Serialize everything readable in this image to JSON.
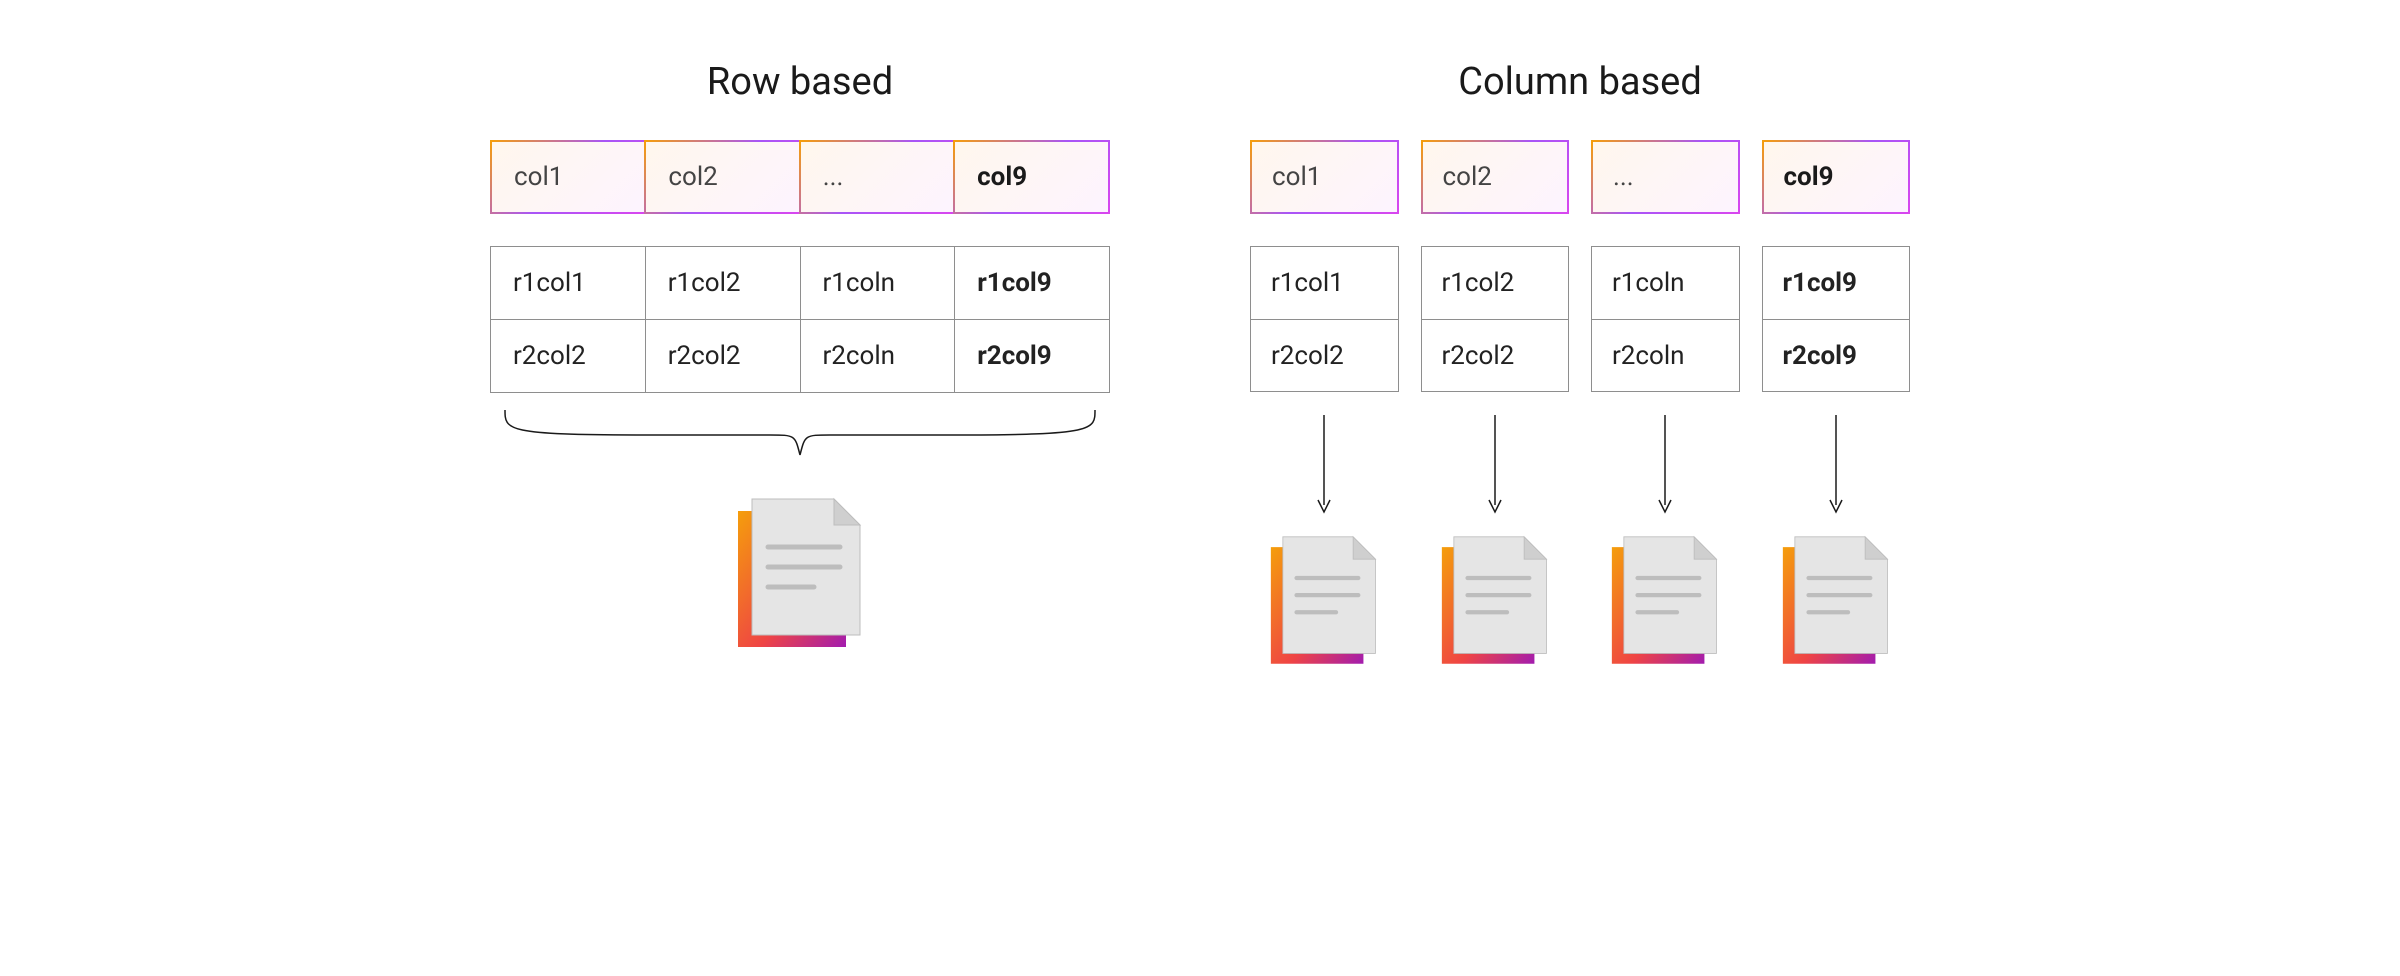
{
  "row_section": {
    "title": "Row based",
    "headers": [
      "col1",
      "col2",
      "...",
      "col9"
    ],
    "header_bold_index": 3,
    "rows": [
      [
        "r1col1",
        "r1col2",
        "r1coln",
        "r1col9"
      ],
      [
        "r2col2",
        "r2col2",
        "r2coln",
        "r2col9"
      ]
    ],
    "bold_col_index": 3
  },
  "col_section": {
    "title": "Column based",
    "columns": [
      {
        "header": "col1",
        "cells": [
          "r1col1",
          "r2col2"
        ],
        "bold": false
      },
      {
        "header": "col2",
        "cells": [
          "r1col2",
          "r2col2"
        ],
        "bold": false
      },
      {
        "header": "...",
        "cells": [
          "r1coln",
          "r2coln"
        ],
        "bold": false
      },
      {
        "header": "col9",
        "cells": [
          "r1col9",
          "r2col9"
        ],
        "bold": true
      }
    ]
  },
  "colors": {
    "grad_start": "#f59e0b",
    "grad_mid": "#d946ef",
    "grad_end": "#a21caf"
  }
}
